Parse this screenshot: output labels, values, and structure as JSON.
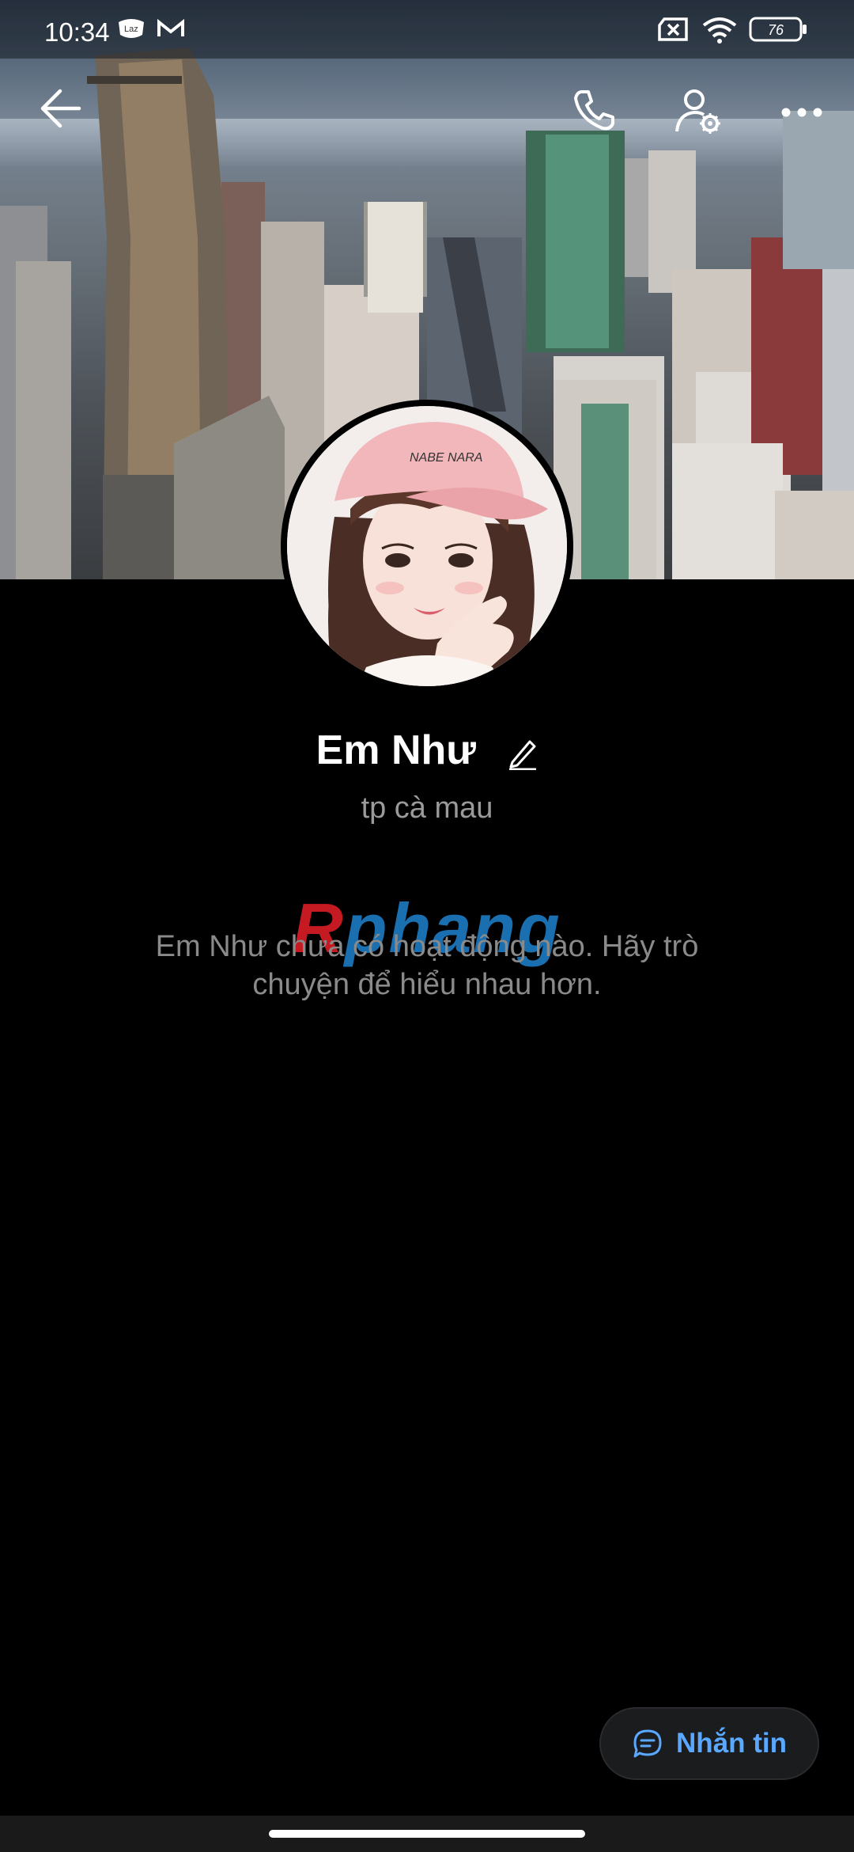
{
  "status_bar": {
    "time": "10:34",
    "battery": "76",
    "icons": [
      "lazada-icon",
      "gmail-icon",
      "sim-off-icon",
      "wifi-icon",
      "battery-icon"
    ]
  },
  "header": {
    "back_icon": "back-arrow-icon",
    "call_icon": "phone-icon",
    "settings_icon": "user-settings-icon",
    "more_icon": "more-icon"
  },
  "profile": {
    "name": "Em Như",
    "location": "tp cà mau",
    "avatar_caption": "NABE NARA"
  },
  "watermark": {
    "first": "R",
    "rest": "phang"
  },
  "empty_state": {
    "line1": "Em Như chưa có hoạt động nào. Hãy trò",
    "line2": "chuyện để hiểu nhau hơn."
  },
  "actions": {
    "message_label": "Nhắn tin"
  },
  "colors": {
    "accent": "#5aa8ff",
    "background": "#000000"
  }
}
